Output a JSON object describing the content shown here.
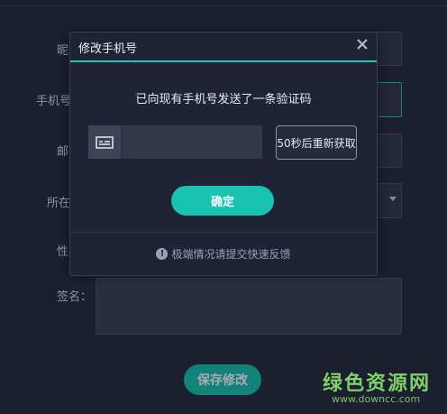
{
  "background_form": {
    "labels": [
      "昵",
      "手机号",
      "邮",
      "所在",
      "性",
      "签名："
    ],
    "save_button": "保存修改"
  },
  "modal": {
    "title": "修改手机号",
    "message": "已向现有手机号发送了一条验证码",
    "code_input": {
      "value": "",
      "placeholder": ""
    },
    "resend_button": "50秒后重新获取",
    "confirm_button": "确定",
    "hint": "极端情况请提交快速反馈"
  },
  "watermark": {
    "name": "绿色资源网",
    "url": "www.downcc.com"
  },
  "colors": {
    "accent": "#18c3b1",
    "background": "#262a3b",
    "modal_background": "#1f2335"
  },
  "icons": [
    "close-icon",
    "sms-code-icon",
    "info-icon",
    "dropdown-caret-icon"
  ]
}
